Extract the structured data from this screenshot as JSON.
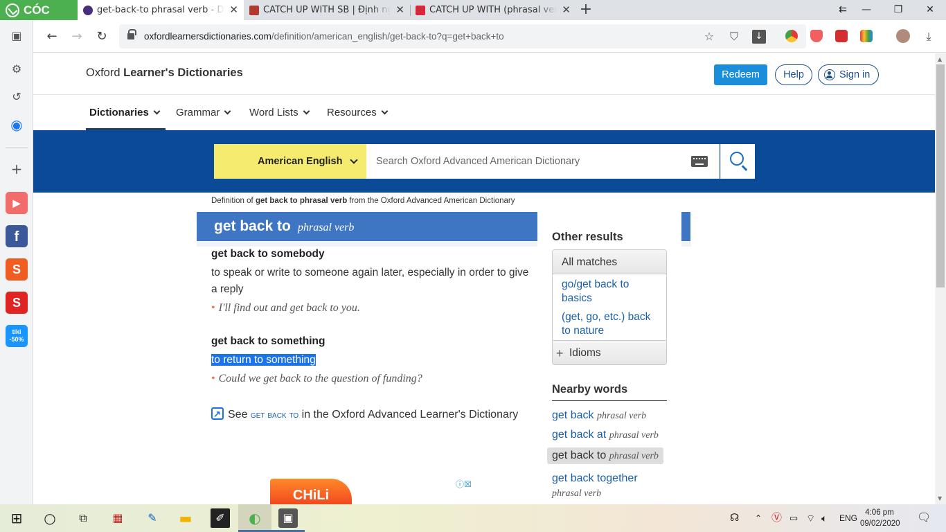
{
  "browser": {
    "brand": "CÓC CÓC",
    "tabs": [
      {
        "title": "get-back-to phrasal verb - De",
        "active": true
      },
      {
        "title": "CATCH UP WITH SB | Định ngh",
        "active": false
      },
      {
        "title": "CATCH UP WITH (phrasal verb",
        "active": false
      }
    ],
    "url_host": "oxfordlearnersdictionaries.com",
    "url_path": "/definition/american_english/get-back-to?q=get+back+to",
    "sidebar_apps": [
      {
        "name": "youtube",
        "color": "#ff4444"
      },
      {
        "name": "facebook",
        "color": "#3b5998",
        "label": "f"
      },
      {
        "name": "shopee",
        "color": "#f05d23",
        "label": "S"
      },
      {
        "name": "sendo",
        "color": "#e02424",
        "label": "S"
      },
      {
        "name": "tiki",
        "color": "#1a94ff",
        "label": "tiki -50%"
      }
    ]
  },
  "site": {
    "logo_plain": "Oxford ",
    "logo_bold": "Learner's Dictionaries",
    "redeem": "Redeem",
    "help": "Help",
    "signin": "Sign in",
    "nav": [
      "Dictionaries",
      "Grammar",
      "Word Lists",
      "Resources"
    ],
    "dict_selector": "American English",
    "search_placeholder": "Search Oxford Advanced American Dictionary"
  },
  "entry": {
    "crumb_pre": "Definition of ",
    "crumb_bold": "get back to phrasal verb",
    "crumb_post": " from the Oxford Advanced American Dictionary",
    "headword": "get back to",
    "pos": "phrasal verb",
    "senses": [
      {
        "head": "get back to somebody",
        "def": "to speak or write to someone again later, especially in order to give a reply",
        "example": "I'll find out and get back to you."
      },
      {
        "head": "get back to something",
        "def": "to return to something",
        "example": "Could we get back to the question of funding?"
      }
    ],
    "see_pre": "See ",
    "see_link": "get back to",
    "see_post": " in the Oxford Advanced Learner's Dictionary"
  },
  "other_results": {
    "title": "Other results",
    "all_matches": "All matches",
    "links": [
      "go/get back to basics",
      "(get, go, etc.) back to nature"
    ],
    "idioms": "Idioms"
  },
  "nearby": {
    "title": "Nearby words",
    "items": [
      {
        "word": "get back",
        "pos": "phrasal verb"
      },
      {
        "word": "get back at",
        "pos": "phrasal verb"
      },
      {
        "word": "get back to",
        "pos": "phrasal verb",
        "current": true
      },
      {
        "word": "get back together",
        "pos": "phrasal verb"
      }
    ]
  },
  "ad": {
    "label": "CHiLi"
  },
  "taskbar": {
    "lang": "ENG",
    "time": "4:06 pm",
    "date": "09/02/2020"
  }
}
